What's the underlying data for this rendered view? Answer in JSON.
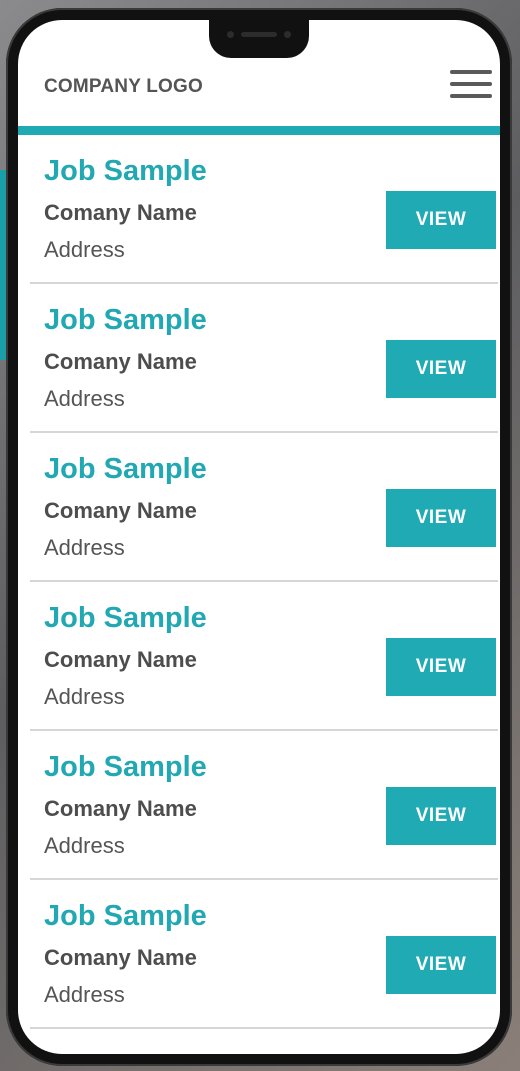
{
  "header": {
    "logo_text": "COMPANY LOGO"
  },
  "jobs": [
    {
      "title": "Job Sample",
      "company": "Comany Name",
      "address": "Address",
      "button": "VIEW"
    },
    {
      "title": "Job Sample",
      "company": "Comany Name",
      "address": "Address",
      "button": "VIEW"
    },
    {
      "title": "Job Sample",
      "company": "Comany Name",
      "address": "Address",
      "button": "VIEW"
    },
    {
      "title": "Job Sample",
      "company": "Comany Name",
      "address": "Address",
      "button": "VIEW"
    },
    {
      "title": "Job Sample",
      "company": "Comany Name",
      "address": "Address",
      "button": "VIEW"
    },
    {
      "title": "Job Sample",
      "company": "Comany Name",
      "address": "Address",
      "button": "VIEW"
    }
  ],
  "colors": {
    "accent": "#1fa9b3",
    "title": "#21a8b2",
    "text_dark": "#4d4d4d"
  }
}
